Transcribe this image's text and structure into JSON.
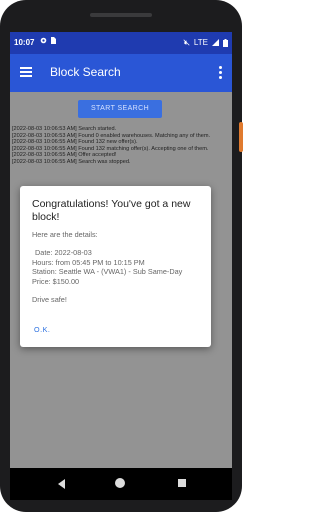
{
  "status": {
    "time": "10:07",
    "network": "LTE"
  },
  "appbar": {
    "title": "Block Search"
  },
  "actions": {
    "start_label": "START SEARCH"
  },
  "log": [
    "[2022-08-03 10:06:53 AM] Search started.",
    "[2022-08-03 10:06:53 AM] Found 0 enabled warehouses. Matching any of them.",
    "[2022-08-03 10:06:55 AM] Found 132 new offer(s).",
    "[2022-08-03 10:06:55 AM] Found 132 matching offer(s). Accepting one of them.",
    "[2022-08-03 10:06:55 AM] Offer accepted!",
    "[2022-08-03 10:06:55 AM] Search was stopped."
  ],
  "dialog": {
    "title": "Congratulations! You've got a new block!",
    "intro": "Here are the details:",
    "date": "Date: 2022-08-03",
    "hours": "Hours: from 05:45 PM to 10:15 PM",
    "station": "Station: Seattle WA - (VWA1) - Sub Same-Day",
    "price": "Price: $150.00",
    "sign_off": "Drive safe!",
    "ok_label": "O.K."
  },
  "colors": {
    "status_bar": "#1f3bb0",
    "app_bar": "#2a56d6",
    "accent": "#2a6fe0"
  }
}
